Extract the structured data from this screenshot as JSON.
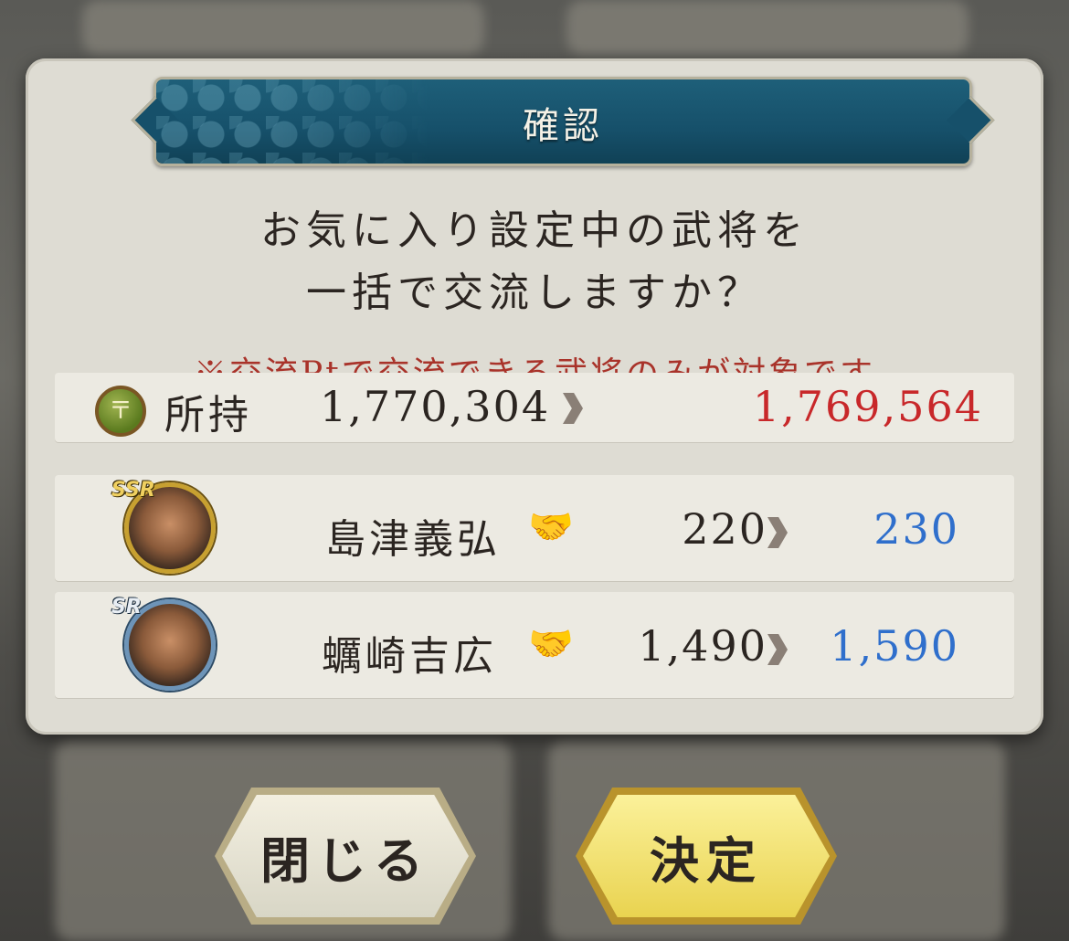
{
  "dialog": {
    "title": "確認",
    "message_line1": "お気に入り設定中の武将を",
    "message_line2": "一括で交流しますか？",
    "note": "※交流Ptで交流できる武将のみが対象です"
  },
  "currency": {
    "icon": "coin-icon",
    "label": "所持",
    "before": "1,770,304",
    "after": "1,769,564"
  },
  "generals": [
    {
      "rarity": "SSR",
      "name": "島津義弘",
      "before": "220",
      "after": "230"
    },
    {
      "rarity": "SR",
      "name": "蠣崎吉広",
      "before": "1,490",
      "after": "1,590"
    }
  ],
  "buttons": {
    "close": "閉じる",
    "confirm": "決定"
  },
  "colors": {
    "after_currency": "#c8282a",
    "after_points": "#2f6fcc",
    "header": "#16506a"
  }
}
